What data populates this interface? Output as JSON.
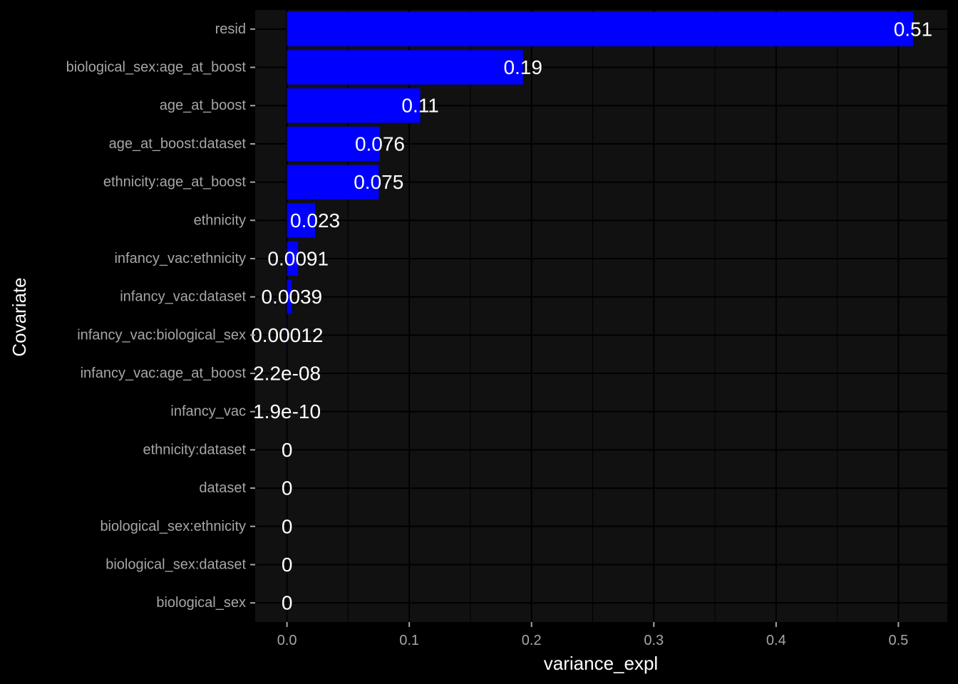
{
  "chart_data": {
    "type": "bar",
    "orientation": "horizontal",
    "xlabel": "variance_expl",
    "ylabel": "Covariate",
    "xlim": [
      -0.026,
      0.54
    ],
    "x_ticks": [
      0.0,
      0.1,
      0.2,
      0.3,
      0.4,
      0.5
    ],
    "x_tick_labels": [
      "0.0",
      "0.1",
      "0.2",
      "0.3",
      "0.4",
      "0.5"
    ],
    "grid": true,
    "legend": "none",
    "colors": {
      "background": "#000000",
      "panel": "#111111",
      "gridline": "#000000",
      "bar": "#0000ff",
      "label": "#ffffff",
      "tick": "#a6a6a6"
    },
    "categories": [
      "resid",
      "biological_sex:age_at_boost",
      "age_at_boost",
      "age_at_boost:dataset",
      "ethnicity:age_at_boost",
      "ethnicity",
      "infancy_vac:ethnicity",
      "infancy_vac:dataset",
      "infancy_vac:biological_sex",
      "infancy_vac:age_at_boost",
      "infancy_vac",
      "ethnicity:dataset",
      "dataset",
      "biological_sex:ethnicity",
      "biological_sex:dataset",
      "biological_sex"
    ],
    "values": [
      0.512,
      0.193,
      0.109,
      0.076,
      0.075,
      0.023,
      0.0091,
      0.0039,
      0.00012,
      2.2e-08,
      1.9e-10,
      0,
      0,
      0,
      0,
      0
    ],
    "value_labels": [
      "0.51",
      "0.19",
      "0.11",
      "0.076",
      "0.075",
      "0.023",
      "0.0091",
      "0.0039",
      "0.00012",
      "2.2e-08",
      "1.9e-10",
      "0",
      "0",
      "0",
      "0",
      "0"
    ]
  }
}
